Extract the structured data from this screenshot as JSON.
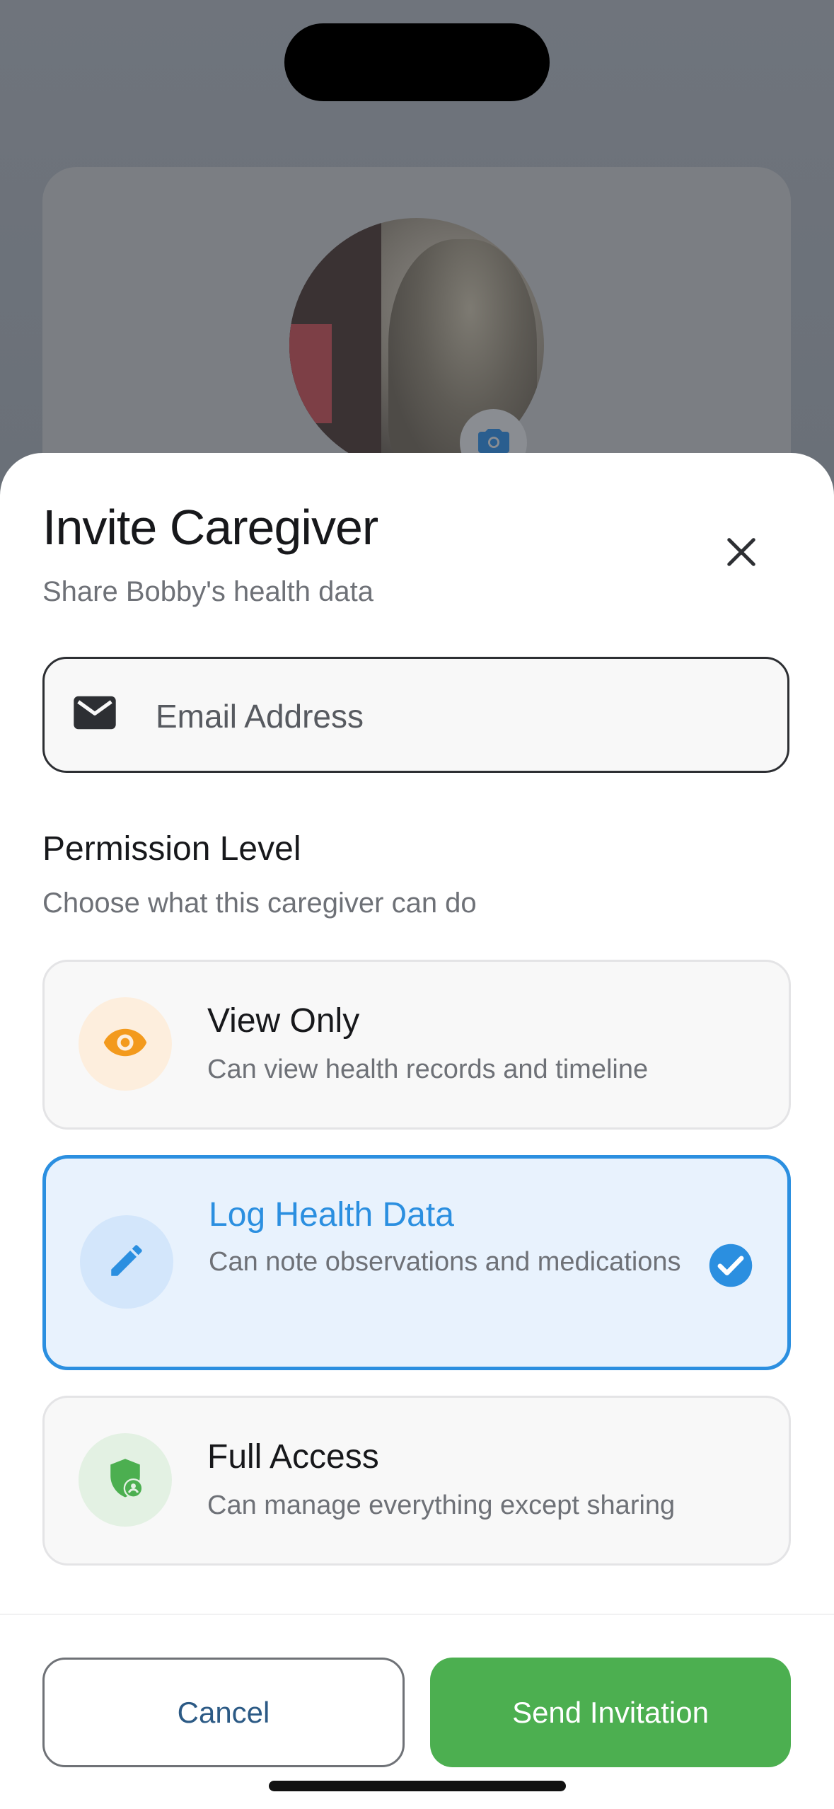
{
  "sheet": {
    "title": "Invite Caregiver",
    "subtitle": "Share Bobby's health data"
  },
  "email": {
    "placeholder": "Email Address",
    "value": ""
  },
  "permission": {
    "title": "Permission Level",
    "subtitle": "Choose what this caregiver can do",
    "options": [
      {
        "label": "View Only",
        "description": "Can view health records and timeline",
        "icon": "eye-icon",
        "color": "#f39a1d",
        "selected": false
      },
      {
        "label": "Log Health Data",
        "description": "Can note observations and medications",
        "icon": "pencil-icon",
        "color": "#2b8fe0",
        "selected": true
      },
      {
        "label": "Full Access",
        "description": "Can manage everything except sharing",
        "icon": "shield-user-icon",
        "color": "#4caf50",
        "selected": false
      }
    ]
  },
  "actions": {
    "cancel_label": "Cancel",
    "send_label": "Send Invitation"
  },
  "colors": {
    "accent_blue": "#2b8fe0",
    "send_green": "#4caf50"
  }
}
